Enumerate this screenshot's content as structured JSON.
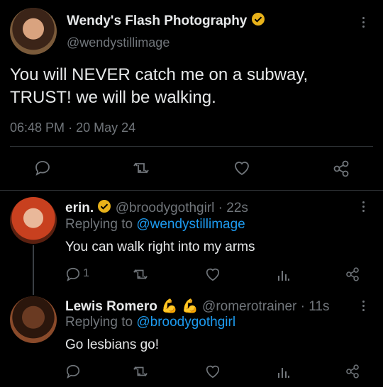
{
  "main_tweet": {
    "display_name": "Wendy's Flash Photography",
    "handle": "@wendystillimage",
    "text_line1": "You will NEVER catch me on a subway,",
    "text_line2": "TRUST! we will be walking.",
    "time": "06:48 PM",
    "separator": "·",
    "date": "20 May 24"
  },
  "replies": [
    {
      "display_name": "erin.",
      "handle": "@broodygothgirl",
      "age": "· 22s",
      "replying_label": "Replying to",
      "replying_to": "@wendystillimage",
      "text": "You can walk right into my arms",
      "reply_count": "1"
    },
    {
      "display_name": "Lewis Romero",
      "emoji": "💪 💪",
      "handle": "@romerotrainer",
      "age": "· 11s",
      "replying_label": "Replying to",
      "replying_to": "@broodygothgirl",
      "text": "Go lesbians go!",
      "reply_count": ""
    }
  ],
  "colors": {
    "verified": "#e8b21a",
    "link": "#1d9bf0",
    "muted": "#71767b"
  },
  "icons": [
    "reply-icon",
    "retweet-icon",
    "like-icon",
    "views-icon",
    "share-icon",
    "more-icon",
    "verified-badge-icon"
  ]
}
